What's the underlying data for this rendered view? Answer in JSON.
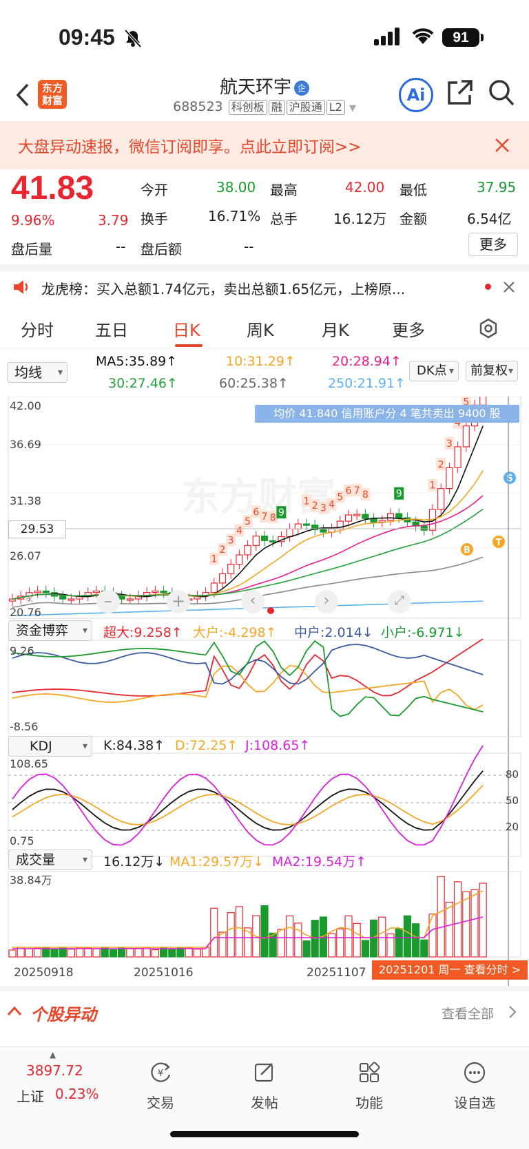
{
  "status": {
    "time": "09:45",
    "battery": "91"
  },
  "header": {
    "logo": "东方\n财富",
    "title": "航天环宇",
    "badge": "企",
    "code": "688523",
    "tags": [
      "科创板",
      "融",
      "沪股通",
      "L2"
    ],
    "ai": "Ai"
  },
  "banner": {
    "text": "大盘异动速报，微信订阅即享。点此立即订阅>>"
  },
  "quote": {
    "price": "41.83",
    "pct": "9.96%",
    "chg": "3.79",
    "open_label": "今开",
    "open": "38.00",
    "high_label": "最高",
    "high": "42.00",
    "low_label": "最低",
    "low": "37.95",
    "turnover_label": "换手",
    "turnover": "16.71%",
    "vol_label": "总手",
    "vol": "16.12万",
    "amt_label": "金额",
    "amt": "6.54亿",
    "ah_vol_label": "盘后量",
    "ah_vol": "--",
    "ah_amt_label": "盘后额",
    "ah_amt": "--",
    "more": "更多"
  },
  "lhb": {
    "text": "龙虎榜：买入总额1.74亿元，卖出总额1.65亿元，上榜原..."
  },
  "tabs": [
    "分时",
    "五日",
    "日K",
    "周K",
    "月K",
    "更多"
  ],
  "ma": {
    "selector": "均线",
    "ma5": "MA5:35.89↑",
    "ma10": "10:31.29↑",
    "ma20": "20:28.94↑",
    "ma30": "30:27.46↑",
    "ma60": "60:25.38↑",
    "ma250": "250:21.91↑",
    "dk": "DK点",
    "fq": "前复权"
  },
  "kline": {
    "y_labels": [
      "42.00",
      "36.69",
      "31.38",
      "26.07",
      "20.76"
    ],
    "cursor_price": "29.53",
    "tooltip": "均价 41.840  信用账户分 4 笔共卖出 9400 股"
  },
  "fund": {
    "selector": "资金博弈",
    "super": "超大:9.258↑",
    "big": "大户:-4.298↑",
    "mid": "中户:2.014↓",
    "small": "小户:-6.971↓",
    "ymax": "9.26",
    "ymin": "-8.56"
  },
  "kdj": {
    "selector": "KDJ",
    "k": "K:84.38↑",
    "d": "D:72.25↑",
    "j": "J:108.65↑",
    "ymax": "108.65",
    "ymin": "0.75",
    "levels": [
      "80",
      "50",
      "20"
    ]
  },
  "volume": {
    "selector": "成交量",
    "vol": "16.12万↓",
    "ma1": "MA1:29.57万↓",
    "ma2": "MA2:19.54万↑",
    "ymax": "38.84万"
  },
  "dates": [
    "20250918",
    "20251016",
    "20251107"
  ],
  "date_tip": "20251201 周一  查看分时 >",
  "movers": {
    "title": "个股异动",
    "all": "查看全部"
  },
  "bottom": {
    "index_val": "3897.72",
    "index_name": "上证",
    "index_pct": "0.23%",
    "trade": "交易",
    "post": "发帖",
    "func": "功能",
    "watch": "设自选"
  },
  "colors": {
    "up": "#e8262f",
    "down": "#1a9a2f",
    "accent": "#e8462a",
    "ma5": "#111111",
    "ma10": "#f5a623",
    "ma20": "#e91e8c",
    "ma30": "#22a33a",
    "ma60": "#888888",
    "ma250": "#5ab0f0"
  },
  "icons": [
    "back-icon",
    "share-icon",
    "search-icon",
    "close-icon",
    "speaker-icon",
    "settings-icon",
    "trade-icon",
    "post-icon",
    "function-icon",
    "watchlist-icon"
  ]
}
